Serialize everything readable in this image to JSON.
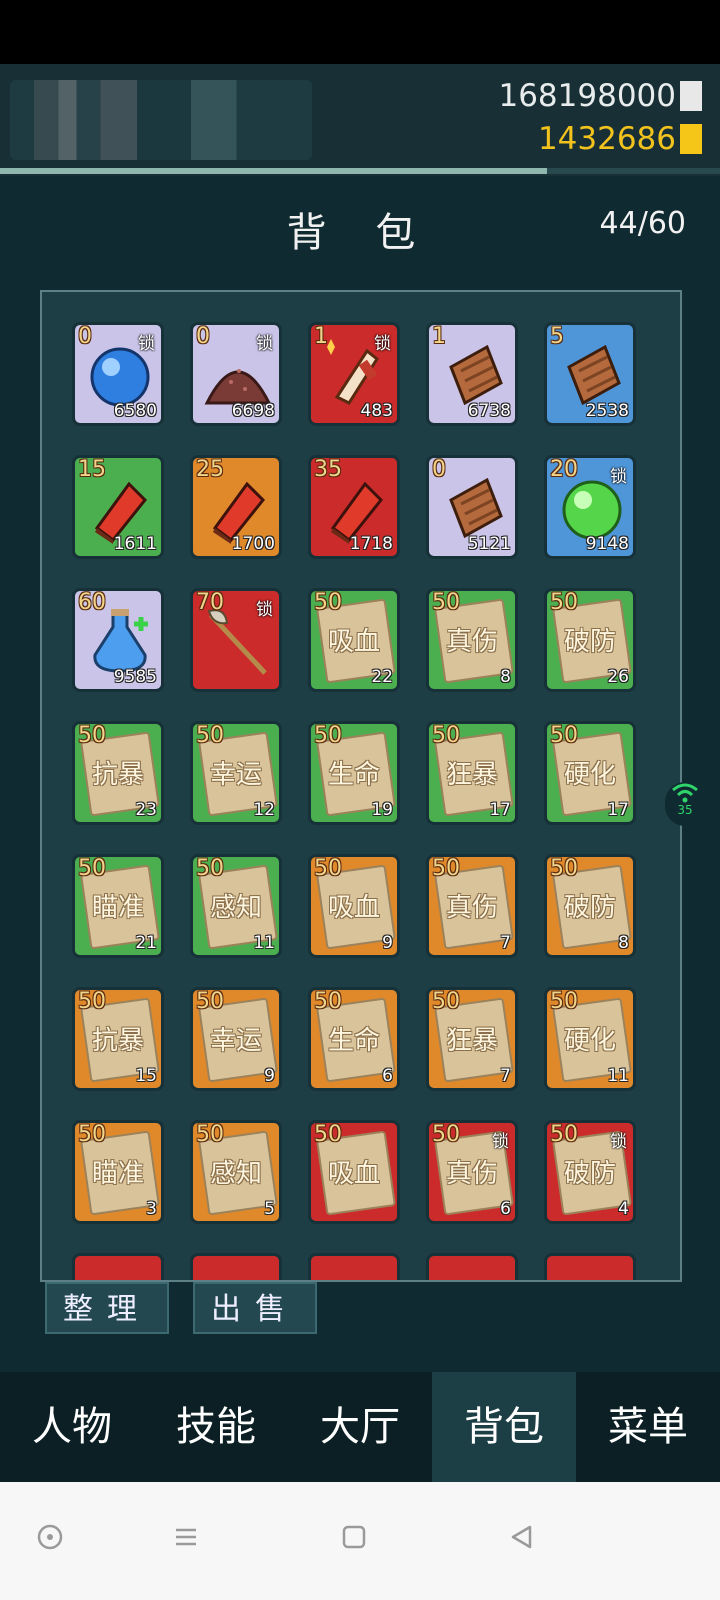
{
  "currency": {
    "silver": "168198000",
    "gold": "1432686"
  },
  "exp_progress": 0.76,
  "title": "背 包",
  "capacity": "44/60",
  "lock_label": "锁",
  "slots": [
    {
      "rarity": "purple",
      "icon": "blue-orb",
      "level": "0",
      "locked": true,
      "qty": "6580"
    },
    {
      "rarity": "purple",
      "icon": "ore-pile",
      "level": "0",
      "locked": true,
      "qty": "6698"
    },
    {
      "rarity": "red",
      "icon": "gauntlet",
      "level": "1",
      "locked": true,
      "qty": "483"
    },
    {
      "rarity": "purple",
      "icon": "armor-plate",
      "level": "1",
      "locked": false,
      "qty": "6738"
    },
    {
      "rarity": "blue",
      "icon": "armor-plate",
      "level": "5",
      "locked": false,
      "qty": "2538"
    },
    {
      "rarity": "green",
      "icon": "red-book",
      "level": "15",
      "locked": false,
      "qty": "1611"
    },
    {
      "rarity": "orange",
      "icon": "red-book",
      "level": "25",
      "locked": false,
      "qty": "1700"
    },
    {
      "rarity": "red",
      "icon": "red-book",
      "level": "35",
      "locked": false,
      "qty": "1718"
    },
    {
      "rarity": "purple",
      "icon": "armor-plate",
      "level": "0",
      "locked": false,
      "qty": "5121"
    },
    {
      "rarity": "blue",
      "icon": "green-orb",
      "level": "20",
      "locked": true,
      "qty": "9148"
    },
    {
      "rarity": "purple",
      "icon": "potion",
      "level": "60",
      "locked": false,
      "qty": "9585"
    },
    {
      "rarity": "red",
      "icon": "halberd",
      "level": "70",
      "locked": true,
      "qty": ""
    },
    {
      "rarity": "green",
      "icon": "scroll",
      "level": "50",
      "locked": false,
      "qty": "22",
      "name": "吸血"
    },
    {
      "rarity": "green",
      "icon": "scroll",
      "level": "50",
      "locked": false,
      "qty": "8",
      "name": "真伤"
    },
    {
      "rarity": "green",
      "icon": "scroll",
      "level": "50",
      "locked": false,
      "qty": "26",
      "name": "破防"
    },
    {
      "rarity": "green",
      "icon": "scroll",
      "level": "50",
      "locked": false,
      "qty": "23",
      "name": "抗暴"
    },
    {
      "rarity": "green",
      "icon": "scroll",
      "level": "50",
      "locked": false,
      "qty": "12",
      "name": "幸运"
    },
    {
      "rarity": "green",
      "icon": "scroll",
      "level": "50",
      "locked": false,
      "qty": "19",
      "name": "生命"
    },
    {
      "rarity": "green",
      "icon": "scroll",
      "level": "50",
      "locked": false,
      "qty": "17",
      "name": "狂暴"
    },
    {
      "rarity": "green",
      "icon": "scroll",
      "level": "50",
      "locked": false,
      "qty": "17",
      "name": "硬化"
    },
    {
      "rarity": "green",
      "icon": "scroll",
      "level": "50",
      "locked": false,
      "qty": "21",
      "name": "瞄准"
    },
    {
      "rarity": "green",
      "icon": "scroll",
      "level": "50",
      "locked": false,
      "qty": "11",
      "name": "感知"
    },
    {
      "rarity": "orange",
      "icon": "scroll",
      "level": "50",
      "locked": false,
      "qty": "9",
      "name": "吸血"
    },
    {
      "rarity": "orange",
      "icon": "scroll",
      "level": "50",
      "locked": false,
      "qty": "7",
      "name": "真伤"
    },
    {
      "rarity": "orange",
      "icon": "scroll",
      "level": "50",
      "locked": false,
      "qty": "8",
      "name": "破防"
    },
    {
      "rarity": "orange",
      "icon": "scroll",
      "level": "50",
      "locked": false,
      "qty": "15",
      "name": "抗暴"
    },
    {
      "rarity": "orange",
      "icon": "scroll",
      "level": "50",
      "locked": false,
      "qty": "9",
      "name": "幸运"
    },
    {
      "rarity": "orange",
      "icon": "scroll",
      "level": "50",
      "locked": false,
      "qty": "6",
      "name": "生命"
    },
    {
      "rarity": "orange",
      "icon": "scroll",
      "level": "50",
      "locked": false,
      "qty": "7",
      "name": "狂暴"
    },
    {
      "rarity": "orange",
      "icon": "scroll",
      "level": "50",
      "locked": false,
      "qty": "11",
      "name": "硬化"
    },
    {
      "rarity": "orange",
      "icon": "scroll",
      "level": "50",
      "locked": false,
      "qty": "3",
      "name": "瞄准"
    },
    {
      "rarity": "orange",
      "icon": "scroll",
      "level": "50",
      "locked": false,
      "qty": "5",
      "name": "感知"
    },
    {
      "rarity": "red",
      "icon": "scroll",
      "level": "50",
      "locked": false,
      "qty": "",
      "name": "吸血"
    },
    {
      "rarity": "red",
      "icon": "scroll",
      "level": "50",
      "locked": true,
      "qty": "6",
      "name": "真伤"
    },
    {
      "rarity": "red",
      "icon": "scroll",
      "level": "50",
      "locked": true,
      "qty": "4",
      "name": "破防"
    },
    {
      "rarity": "red",
      "icon": "",
      "level": "",
      "locked": false,
      "qty": ""
    },
    {
      "rarity": "red",
      "icon": "",
      "level": "",
      "locked": false,
      "qty": ""
    },
    {
      "rarity": "red",
      "icon": "",
      "level": "",
      "locked": false,
      "qty": ""
    },
    {
      "rarity": "red",
      "icon": "",
      "level": "",
      "locked": false,
      "qty": ""
    },
    {
      "rarity": "red",
      "icon": "",
      "level": "",
      "locked": false,
      "qty": ""
    }
  ],
  "buttons": {
    "sort": "整理",
    "sell": "出售"
  },
  "nav": [
    "人物",
    "技能",
    "大厅",
    "背包",
    "菜单"
  ],
  "nav_active": 3,
  "wifi_label": "35",
  "colors": {
    "gold": "#f5c518",
    "panel": "#1d3e45"
  }
}
